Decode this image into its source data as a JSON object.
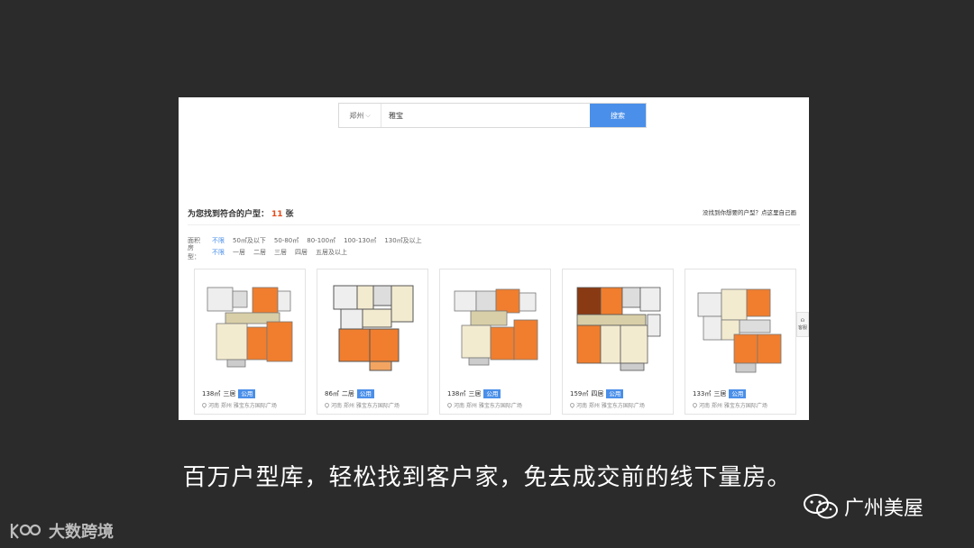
{
  "search": {
    "city": "郑州",
    "query": "雅宝",
    "button_label": "搜索"
  },
  "results": {
    "title": "为您找到符合的户型：",
    "count": "11",
    "unit": "张",
    "custom_link": "没找到你想要的户型？点这里自己画"
  },
  "filters": {
    "area": {
      "label": "面积",
      "options": [
        "不限",
        "50㎡及以下",
        "50-80㎡",
        "80-100㎡",
        "100-130㎡",
        "130㎡及以上"
      ]
    },
    "rooms": {
      "label": "房型：",
      "options": [
        "不限",
        "一居",
        "二居",
        "三居",
        "四居",
        "五居及以上"
      ]
    }
  },
  "cards": [
    {
      "area": "138㎡",
      "rooms": "三居",
      "tag": "公用",
      "location": "河南 郑州  雅宝东方国际广场"
    },
    {
      "area": "86㎡",
      "rooms": "二居",
      "tag": "公用",
      "location": "河南 郑州  雅宝东方国际广场"
    },
    {
      "area": "138㎡",
      "rooms": "三居",
      "tag": "公用",
      "location": "河南 郑州  雅宝东方国际广场"
    },
    {
      "area": "159㎡",
      "rooms": "四居",
      "tag": "公用",
      "location": "河南 郑州  雅宝东方国际广场"
    },
    {
      "area": "133㎡",
      "rooms": "三居",
      "tag": "公用",
      "location": "河南 郑州  雅宝东方国际广场"
    }
  ],
  "float_button": {
    "label": "客服"
  },
  "caption": "百万户型库，轻松找到客户家，免去成交前的线下量房。",
  "watermarks": {
    "right": "广州美屋",
    "left": "大数跨境"
  },
  "colors": {
    "accent": "#4a8fe9",
    "count": "#e64a19",
    "room_orange": "#f07e2e",
    "room_beige": "#f3ebd0"
  }
}
